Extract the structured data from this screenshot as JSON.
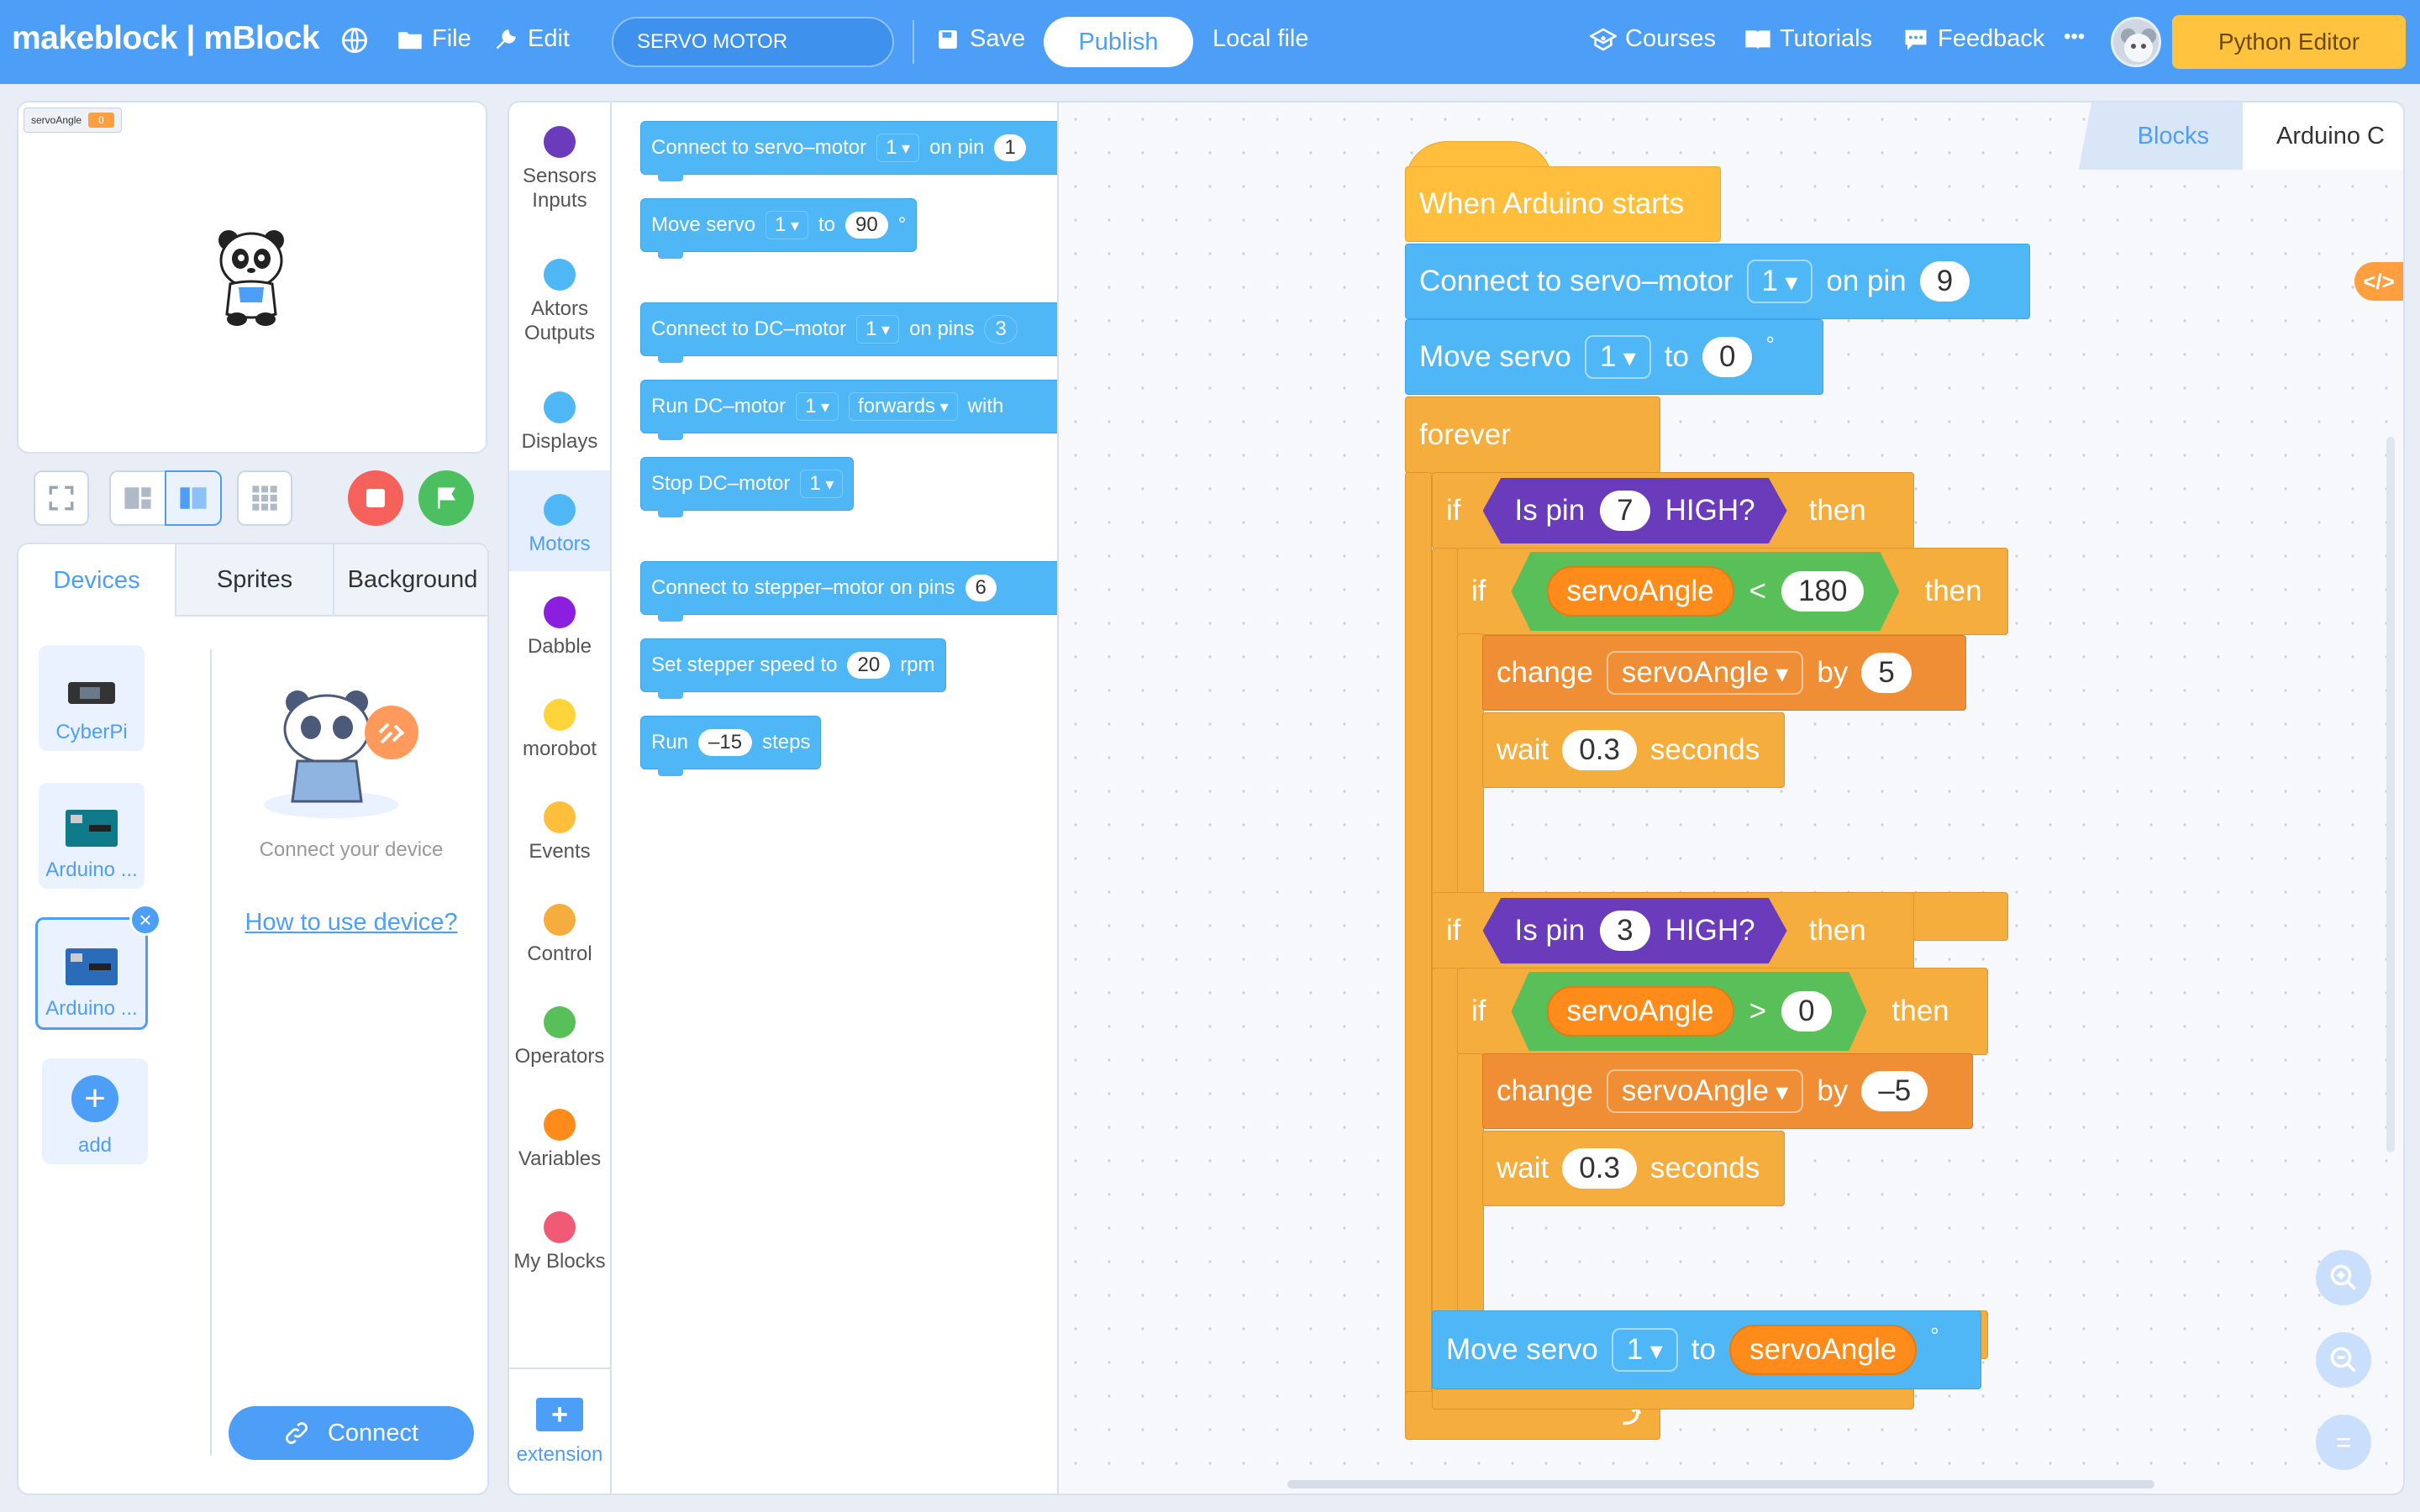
{
  "topbar": {
    "logo": "makeblock | mBlock",
    "file": "File",
    "edit": "Edit",
    "project_name": "SERVO MOTOR",
    "save": "Save",
    "publish": "Publish",
    "local_file": "Local file",
    "courses": "Courses",
    "tutorials": "Tutorials",
    "feedback": "Feedback",
    "more": "•••",
    "python_editor": "Python Editor"
  },
  "stage": {
    "variable_name": "servoAngle",
    "variable_value": "0"
  },
  "device_panel": {
    "tabs": [
      "Devices",
      "Sprites",
      "Background"
    ],
    "devices": [
      "CyberPi",
      "Arduino ...",
      "Arduino ...",
      "add"
    ],
    "connect_hint": "Connect your device",
    "how_to": "How to use device?",
    "connect": "Connect"
  },
  "categories": [
    {
      "label": "Sensors Inputs",
      "color": "#6a3cbc"
    },
    {
      "label": "Aktors Outputs",
      "color": "#4fb7f6"
    },
    {
      "label": "Displays",
      "color": "#4fb7f6"
    },
    {
      "label": "Motors",
      "color": "#4fb7f6"
    },
    {
      "label": "Dabble",
      "color": "#8b1fe0"
    },
    {
      "label": "morobot",
      "color": "#ffd43b"
    },
    {
      "label": "Events",
      "color": "#ffbf3c"
    },
    {
      "label": "Control",
      "color": "#f5ad3d"
    },
    {
      "label": "Operators",
      "color": "#59c059"
    },
    {
      "label": "Variables",
      "color": "#ff8c1a"
    },
    {
      "label": "My Blocks",
      "color": "#f05a75"
    }
  ],
  "extension": "extension",
  "palette": {
    "b1": {
      "text": "Connect to servo–motor",
      "dd": "1",
      "text2": "on pin",
      "pill": "1"
    },
    "b2": {
      "text": "Move servo",
      "dd": "1",
      "text2": "to",
      "pill": "90",
      "unit": "°"
    },
    "b3": {
      "text": "Connect to DC–motor",
      "dd": "1",
      "text2": "on pins",
      "pill": "3"
    },
    "b4": {
      "text": "Run DC–motor",
      "dd": "1",
      "dd2": "forwards",
      "text2": "with"
    },
    "b5": {
      "text": "Stop DC–motor",
      "dd": "1"
    },
    "b6": {
      "text": "Connect to stepper–motor on pins",
      "pill": "6"
    },
    "b7": {
      "text": "Set stepper speed to",
      "pill": "20",
      "text2": "rpm"
    },
    "b8": {
      "text": "Run",
      "pill": "–15",
      "text2": "steps"
    }
  },
  "workspace": {
    "tabs": [
      "Blocks",
      "Arduino C"
    ],
    "code_toggle": "</>",
    "script": {
      "hat": "When Arduino starts",
      "connect": {
        "text": "Connect to servo–motor",
        "dd": "1",
        "text2": "on pin",
        "pill": "9"
      },
      "move1": {
        "text": "Move servo",
        "dd": "1",
        "text2": "to",
        "pill": "0",
        "unit": "°"
      },
      "forever": "forever",
      "if1": {
        "if": "if",
        "is_pin": "Is pin",
        "pin": "7",
        "high": "HIGH?",
        "then": "then"
      },
      "if1_inner": {
        "if": "if",
        "var": "servoAngle",
        "op": "<",
        "value": "180",
        "then": "then"
      },
      "change1": {
        "text": "change",
        "var": "servoAngle",
        "by": "by",
        "value": "5"
      },
      "wait1": {
        "text": "wait",
        "value": "0.3",
        "unit": "seconds"
      },
      "if2": {
        "if": "if",
        "is_pin": "Is pin",
        "pin": "3",
        "high": "HIGH?",
        "then": "then"
      },
      "if2_inner": {
        "if": "if",
        "var": "servoAngle",
        "op": ">",
        "value": "0",
        "then": "then"
      },
      "change2": {
        "text": "change",
        "var": "servoAngle",
        "by": "by",
        "value": "–5"
      },
      "wait2": {
        "text": "wait",
        "value": "0.3",
        "unit": "seconds"
      },
      "move2": {
        "text": "Move servo",
        "dd": "1",
        "text2": "to",
        "var": "servoAngle",
        "unit": "°"
      }
    },
    "zoom": {
      "in": "+",
      "out": "−",
      "reset": "="
    }
  }
}
